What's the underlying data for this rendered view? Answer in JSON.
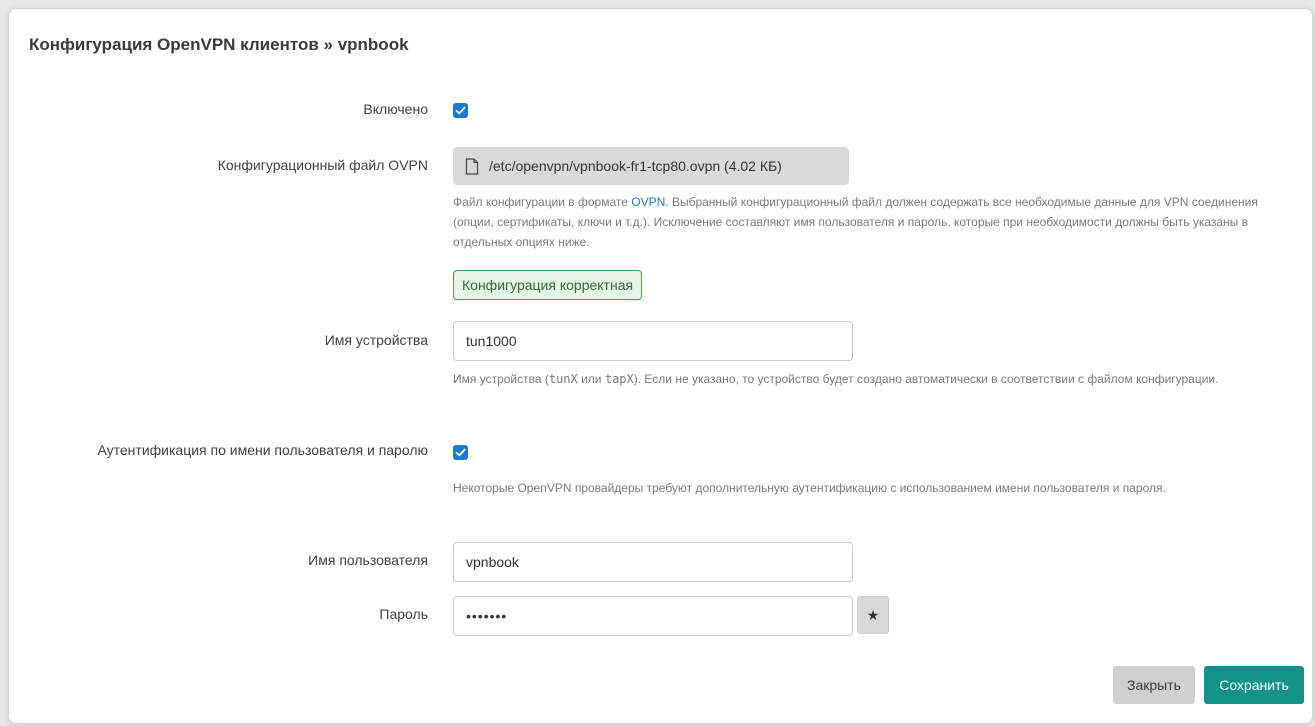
{
  "dialog": {
    "title": "Конфигурация OpenVPN клиентов » vpnbook"
  },
  "enabled": {
    "label": "Включено",
    "checked": true
  },
  "config_file": {
    "label": "Конфигурационный файл OVPN",
    "file_icon": "file-icon",
    "value": "/etc/openvpn/vpnbook-fr1-tcp80.ovpn (4.02 КБ)",
    "help_before_link": "Файл конфигурации в формате ",
    "help_link": "OVPN",
    "help_after_link": ". Выбранный конфигурационный файл должен содержать все необходимые данные для VPN соединения (опции, сертификаты, ключи и т.д.). Исключение составляют имя пользователя и пароль, которые при необходимости должны быть указаны в отдельных опциях ниже.",
    "status": "Конфигурация корректная"
  },
  "device": {
    "label": "Имя устройства",
    "value": "tun1000",
    "help_part1": "Имя устройства (",
    "help_code1": "tunX",
    "help_part2": " или ",
    "help_code2": "tapX",
    "help_part3": "). Если не указано, то устройство будет создано автоматически в соответствии с файлом конфигурации."
  },
  "auth": {
    "label": "Аутентификация по имени пользователя и паролю",
    "checked": true,
    "help": "Некоторые OpenVPN провайдеры требуют дополнительную аутентификацию с использованием имени пользователя и пароля."
  },
  "username": {
    "label": "Имя пользователя",
    "value": "vpnbook"
  },
  "password": {
    "label": "Пароль",
    "value": "•••••••",
    "reveal_symbol": "★",
    "reveal_icon": "star-icon"
  },
  "actions": {
    "close_label": "Закрыть",
    "save_label": "Сохранить"
  },
  "colors": {
    "accent": "#1e7ad0",
    "save": "#14928a",
    "valid_border": "#3da24a"
  }
}
